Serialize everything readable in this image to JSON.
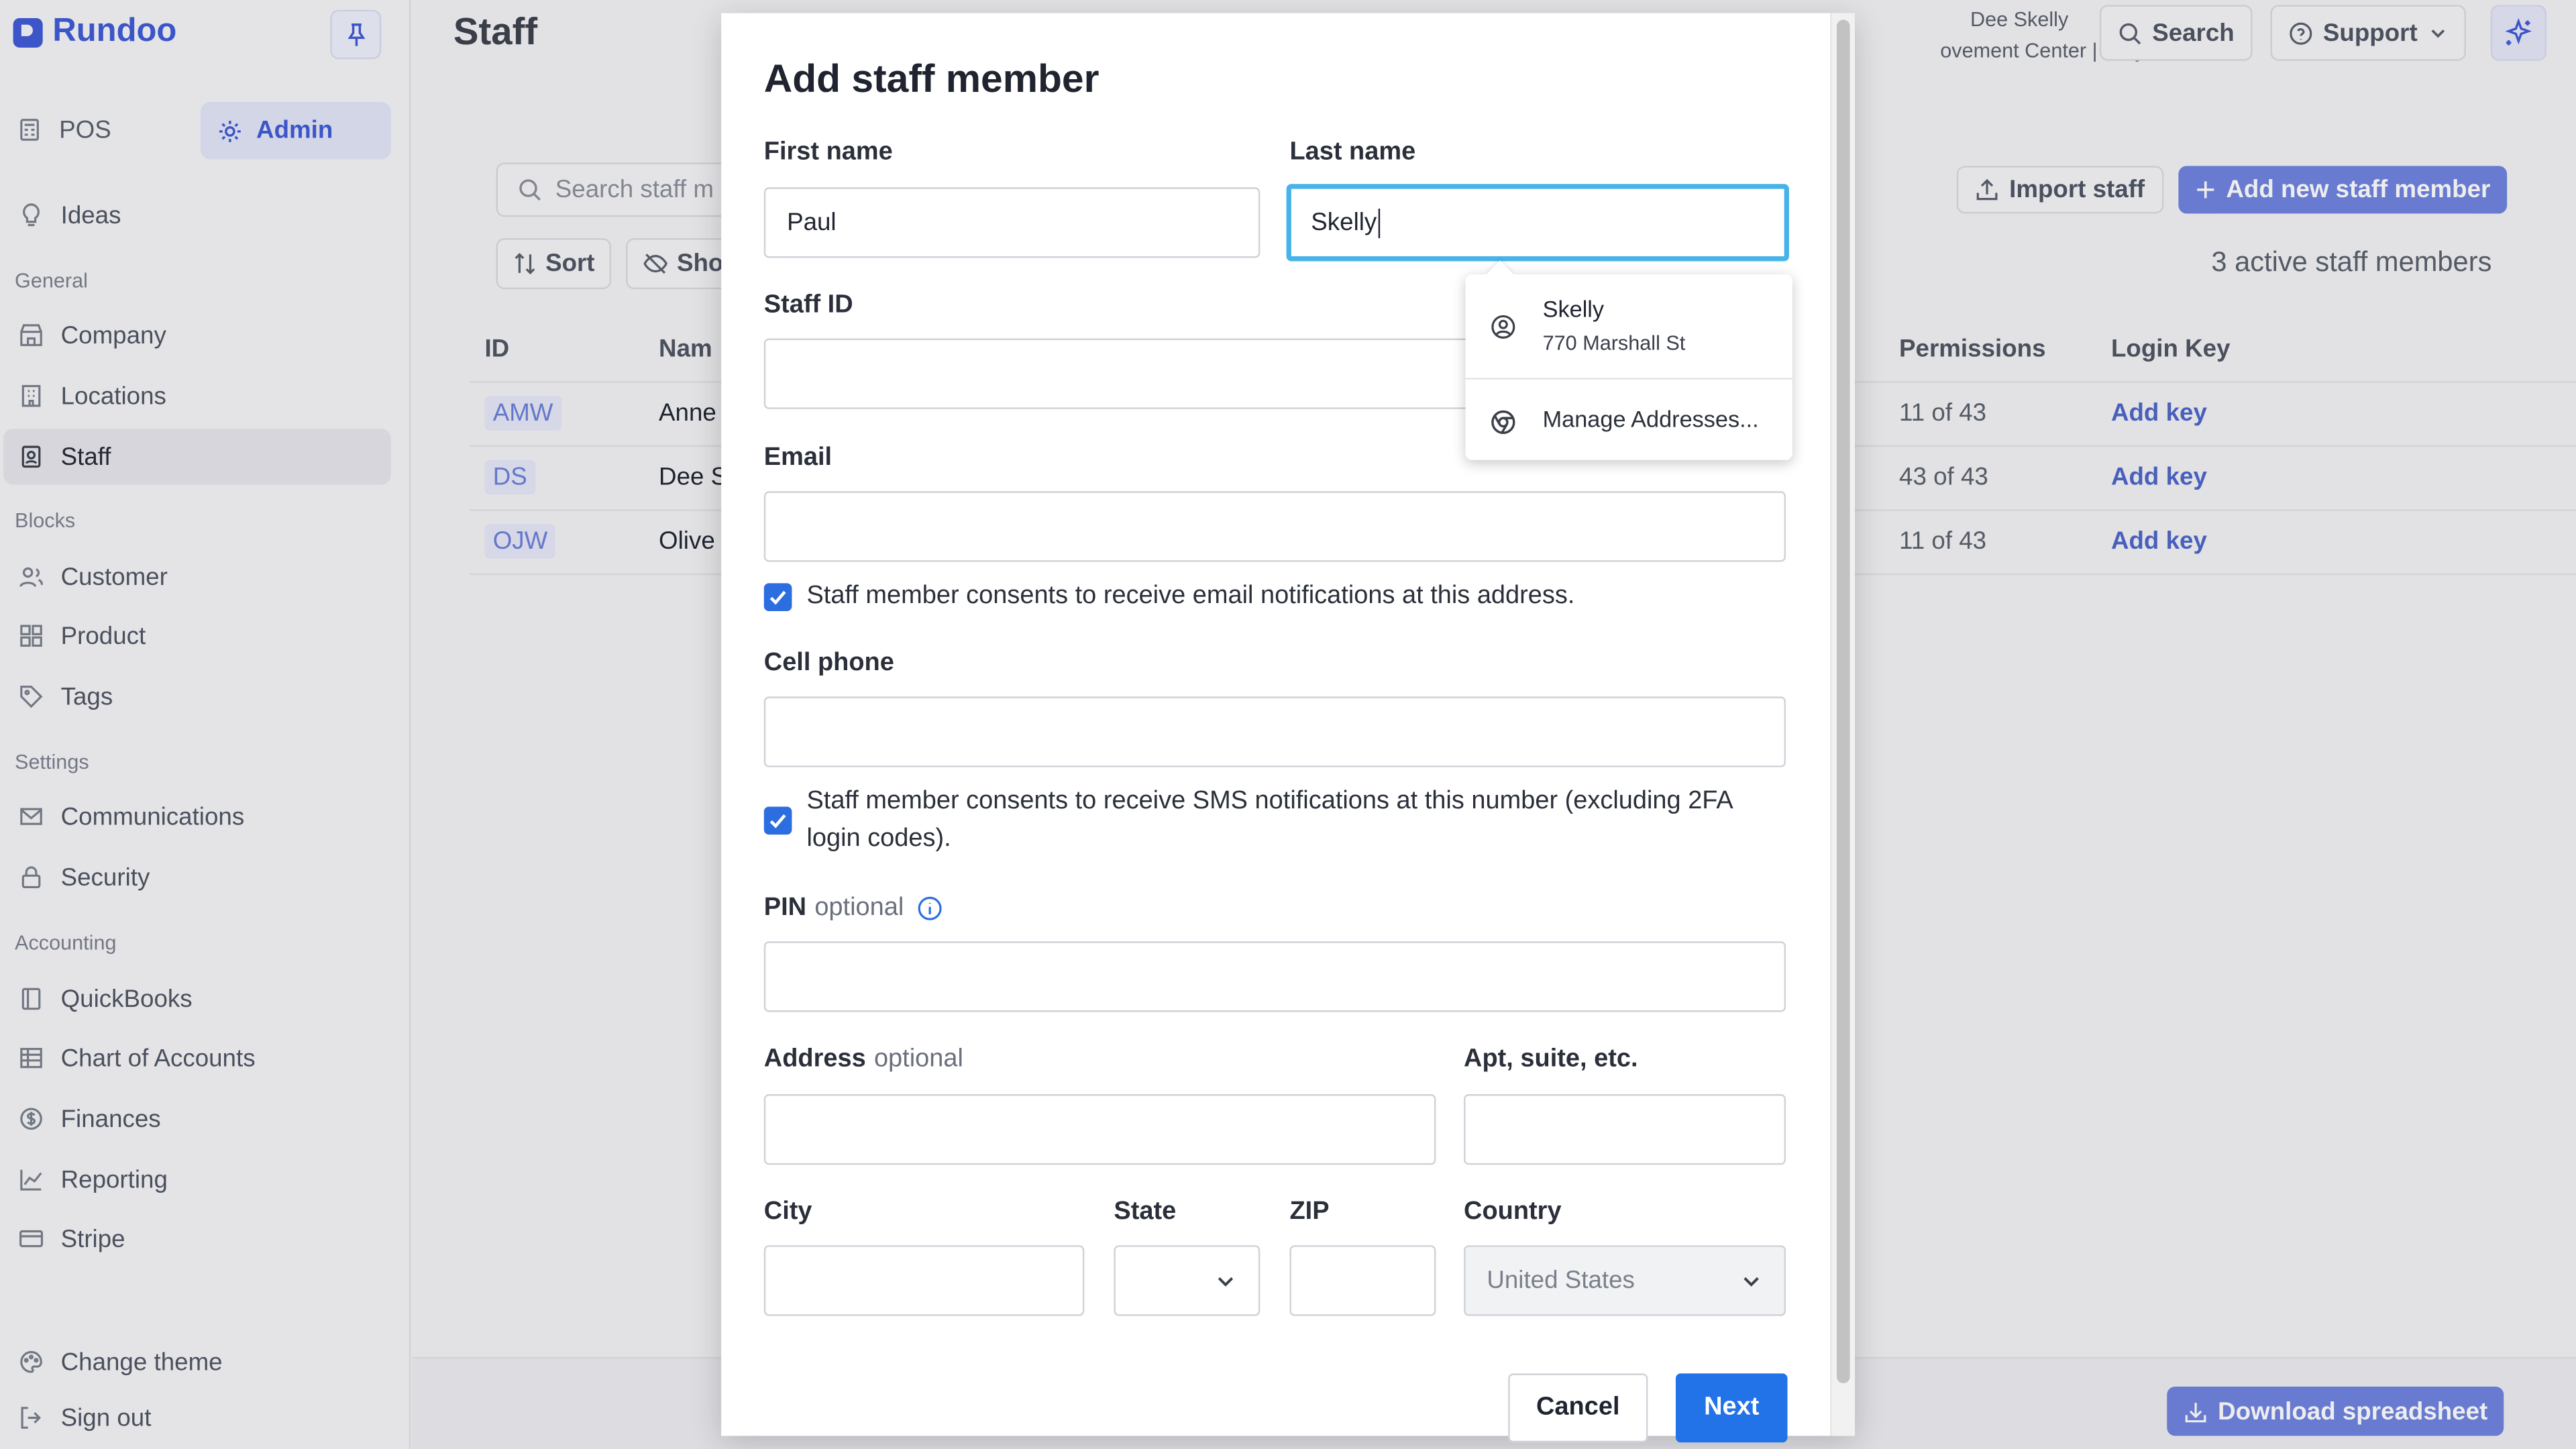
{
  "app": {
    "name": "Rundoo"
  },
  "sidebar": {
    "pos_label": "POS",
    "admin_label": "Admin",
    "ideas_label": "Ideas",
    "sections": {
      "general": "General",
      "blocks": "Blocks",
      "settings": "Settings",
      "accounting": "Accounting"
    },
    "general_items": [
      "Company",
      "Locations",
      "Staff"
    ],
    "blocks_items": [
      "Customer",
      "Product",
      "Tags"
    ],
    "settings_items": [
      "Communications",
      "Security"
    ],
    "accounting_items": [
      "QuickBooks",
      "Chart of Accounts",
      "Finances",
      "Reporting",
      "Stripe"
    ],
    "bottom_items": [
      "Change theme",
      "Sign out"
    ]
  },
  "header": {
    "title": "Staff",
    "user_name": "Dee Skelly",
    "user_location": "ovement Center | Bray",
    "search_label": "Search",
    "support_label": "Support"
  },
  "toolbar": {
    "search_placeholder": "Search staff m",
    "sort_label": "Sort",
    "show_label": "Sho",
    "import_label": "Import staff",
    "add_new_label": "Add new staff member",
    "active_count": "3 active staff members"
  },
  "table": {
    "headers": [
      "ID",
      "Nam",
      "Permissions",
      "Login Key"
    ],
    "rows": [
      {
        "id": "AMW",
        "name": "Anne",
        "permissions": "11 of 43",
        "key": "Add key"
      },
      {
        "id": "DS",
        "name": "Dee S",
        "permissions": "43 of 43",
        "key": "Add key"
      },
      {
        "id": "OJW",
        "name": "Olive",
        "permissions": "11 of 43",
        "key": "Add key"
      }
    ]
  },
  "footer": {
    "download_label": "Download spreadsheet"
  },
  "modal": {
    "title": "Add staff member",
    "first_name_label": "First name",
    "first_name_value": "Paul",
    "last_name_label": "Last name",
    "last_name_value": "Skelly",
    "staff_id_label": "Staff ID",
    "email_label": "Email",
    "email_consent": "Staff member consents to receive email notifications at this address.",
    "cell_label": "Cell phone",
    "sms_consent_line1": "Staff member consents to receive SMS notifications at this number (excluding 2FA",
    "sms_consent_line2": "login codes).",
    "pin_label": "PIN",
    "optional": "optional",
    "address_label": "Address",
    "apt_label": "Apt, suite, etc.",
    "city_label": "City",
    "state_label": "State",
    "zip_label": "ZIP",
    "country_label": "Country",
    "country_value": "United States",
    "cancel_label": "Cancel",
    "next_label": "Next"
  },
  "autocomplete": {
    "suggestion_name": "Skelly",
    "suggestion_address": "770 Marshall St",
    "manage_label": "Manage Addresses..."
  },
  "colors": {
    "brand": "#3f5bd6",
    "primary_button": "#2272e8",
    "focus_ring": "#48b3e9",
    "checkbox": "#2c6ee0"
  }
}
